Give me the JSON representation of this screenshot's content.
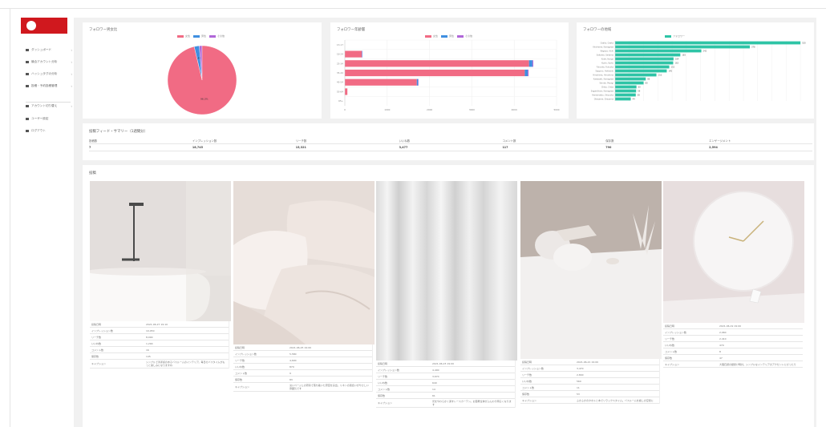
{
  "sidebar": {
    "items": [
      {
        "label": "ダッシュボード",
        "icon": "dashboard-icon",
        "chevron": "‹"
      },
      {
        "label": "競合アカウント分析",
        "icon": "chart-icon",
        "chevron": "‹"
      },
      {
        "label": "ハッシュタグの分析",
        "icon": "hashtag-icon",
        "chevron": "‹"
      },
      {
        "label": "投稿・予約投稿管理",
        "icon": "calendar-icon",
        "chevron": "‹"
      },
      {
        "label": "アカウント切り替え",
        "icon": "switch-icon",
        "chevron": "‹"
      },
      {
        "label": "ユーザー設定",
        "icon": "user-icon"
      },
      {
        "label": "ログアウト",
        "icon": "logout-icon"
      }
    ]
  },
  "charts": {
    "gender": {
      "title": "フォロワー男女比"
    },
    "age": {
      "title": "フォロワー年齢層"
    },
    "region": {
      "title": "フォロワーの地域"
    }
  },
  "colors": {
    "female": "#f16b84",
    "male": "#3f8fe0",
    "other": "#b067d8",
    "region": "#2ec4a6",
    "brand": "#d0181e"
  },
  "chart_data": [
    {
      "type": "pie",
      "legend": [
        "女性",
        "男性",
        "その他"
      ],
      "values": [
        96.3,
        2.4,
        1.3
      ],
      "slice_labels": [
        "96.3%",
        "2.4%",
        ""
      ]
    },
    {
      "type": "bar",
      "orientation": "horizontal",
      "stacked": true,
      "legend": [
        "女性",
        "男性",
        "その他"
      ],
      "categories": [
        "13-17",
        "18-24",
        "25-34",
        "35-44",
        "45-54",
        "55-64",
        "65+"
      ],
      "series": [
        {
          "name": "女性",
          "values": [
            0,
            400,
            4350,
            4250,
            1700,
            60,
            0
          ]
        },
        {
          "name": "男性",
          "values": [
            0,
            10,
            80,
            70,
            30,
            0,
            0
          ]
        },
        {
          "name": "その他",
          "values": [
            0,
            5,
            20,
            20,
            10,
            0,
            0
          ]
        }
      ],
      "xticks": [
        "0",
        "1000",
        "2000",
        "3000",
        "4000",
        "5000"
      ],
      "xlim": [
        0,
        5000
      ]
    },
    {
      "type": "bar",
      "orientation": "horizontal",
      "legend": [
        "フォロワー"
      ],
      "categories": [
        "Osaka, Osaka",
        "Yokohama, Kanagawa",
        "Nagoya, Aichi",
        "Saitama, Saitama",
        "Kobe, Hyogo",
        "Kyoto, Kyoto",
        "Fukuoka, Fukuoka",
        "Sapporo, Hokkaido",
        "Hiroshima, Hiroshima",
        "Kawasaki, Kanagawa",
        "Sendai, Miyagi",
        "Chiba, Chiba",
        "Sagamihara, Kanagawa",
        "Hamamatsu, Shizuoka",
        "Okayama, Okayama"
      ],
      "values": [
        520,
        378,
        242,
        183,
        164,
        163,
        152,
        145,
        116,
        86,
        80,
        60,
        59,
        58,
        44
      ],
      "data_labels": [
        "520",
        "378",
        "242",
        "183",
        "164",
        "163",
        "152",
        "145",
        "116",
        "86",
        "80",
        "60",
        "59",
        "58",
        "44"
      ],
      "xlim": [
        0,
        540
      ]
    }
  ],
  "stats": {
    "title": "投稿フィード・サマリー（1週間分）",
    "headers": [
      "投稿数",
      "インプレッション数",
      "リーチ数",
      "いいね数",
      "コメント数",
      "保存数",
      "エンゲージメント"
    ],
    "values": [
      "7",
      "18,745",
      "15,321",
      "3,477",
      "117",
      "790",
      "2,594"
    ]
  },
  "posts": {
    "title": "投稿",
    "items": [
      {
        "rows": [
          [
            "投稿日時",
            "2021-06-27 19:10"
          ],
          [
            "インプレッション数",
            "10,050"
          ],
          [
            "リーチ数",
            "8,090"
          ],
          [
            "いいね数",
            "1,290"
          ],
          [
            "コメント数",
            "16"
          ],
          [
            "保存数",
            "145"
          ],
          [
            "キャプション",
            "シンプルで清潔感のあるバスルームのインテリア。毎日のバスタイムがもっと楽しみになりますね"
          ]
        ]
      },
      {
        "rows": [
          [
            "投稿日時",
            "2021-06-25 19:00"
          ],
          [
            "インプレッション数",
            "5,580"
          ],
          [
            "リーチ数",
            "4,690"
          ],
          [
            "いいね数",
            "870"
          ],
          [
            "コメント数",
            "9"
          ],
          [
            "保存数",
            "83"
          ],
          [
            "キャプション",
            "淡いベージュの寝具で落ち着いた寝室を演出。リネンの風合いがやさしい雰囲気です"
          ]
        ]
      },
      {
        "rows": [
          [
            "投稿日時",
            "2021-06-23 19:00"
          ],
          [
            "インプレッション数",
            "4,400"
          ],
          [
            "リーチ数",
            "3,670"
          ],
          [
            "いいね数",
            "640"
          ],
          [
            "コメント数",
            "14"
          ],
          [
            "保存数",
            "61"
          ],
          [
            "キャプション",
            "光をやわらかく通すレースカーテン。お部屋全体がふんわり明るくなります"
          ]
        ]
      },
      {
        "rows": [
          [
            "投稿日時",
            "2021-06-21 19:00"
          ],
          [
            "インプレッション数",
            "3,470"
          ],
          [
            "リーチ数",
            "2,840"
          ],
          [
            "いいね数",
            "560"
          ],
          [
            "コメント数",
            "11"
          ],
          [
            "保存数",
            "53"
          ],
          [
            "キャプション",
            "ふかふかのタオルと本でリラックスタイム。バスルームを癒しの空間に"
          ]
        ]
      },
      {
        "rows": [
          [
            "投稿日時",
            "2021-06-19 19:00"
          ],
          [
            "インプレッション数",
            "2,960"
          ],
          [
            "リーチ数",
            "2,410"
          ],
          [
            "いいね数",
            "470"
          ],
          [
            "コメント数",
            "8"
          ],
          [
            "保存数",
            "47"
          ],
          [
            "キャプション",
            "大理石調の壁掛け時計。シンプルなインテリアのアクセントにぴったり"
          ]
        ]
      }
    ]
  }
}
